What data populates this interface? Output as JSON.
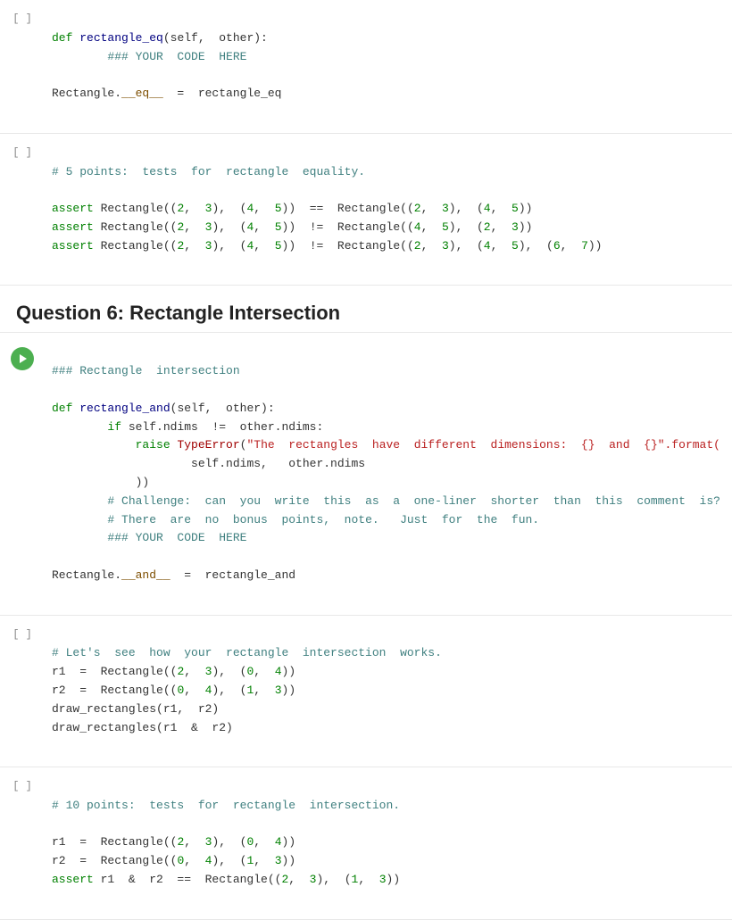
{
  "section_header": "Question 6: Rectangle Intersection",
  "cells": [
    {
      "id": "cell-eq-def",
      "gutter": "[ ]",
      "type": "code",
      "lines": [
        {
          "parts": [
            {
              "text": "def ",
              "cls": "kw"
            },
            {
              "text": "rectangle_eq",
              "cls": "fn"
            },
            {
              "text": "(self,  other):",
              "cls": "bl"
            }
          ]
        },
        {
          "parts": [
            {
              "text": "        ",
              "cls": "bl"
            },
            {
              "text": "### YOUR  CODE  HERE",
              "cls": "comment"
            }
          ]
        },
        {
          "parts": [
            {
              "text": "",
              "cls": "bl"
            }
          ]
        },
        {
          "parts": [
            {
              "text": "Rectangle.",
              "cls": "bl"
            },
            {
              "text": "__eq__",
              "cls": "attr"
            },
            {
              "text": "  =  rectangle_eq",
              "cls": "bl"
            }
          ]
        }
      ]
    },
    {
      "id": "cell-eq-test",
      "gutter": "[ ]",
      "type": "code",
      "lines": [
        {
          "parts": [
            {
              "text": "# 5 points:  tests  for  rectangle  equality.",
              "cls": "comment"
            }
          ]
        },
        {
          "parts": [
            {
              "text": "",
              "cls": "bl"
            }
          ]
        },
        {
          "parts": [
            {
              "text": "assert ",
              "cls": "assert-kw"
            },
            {
              "text": "Rectangle((",
              "cls": "bl"
            },
            {
              "text": "2",
              "cls": "num"
            },
            {
              "text": ",  ",
              "cls": "bl"
            },
            {
              "text": "3",
              "cls": "num"
            },
            {
              "text": "),   (",
              "cls": "bl"
            },
            {
              "text": "4",
              "cls": "num"
            },
            {
              "text": ",   ",
              "cls": "bl"
            },
            {
              "text": "5",
              "cls": "num"
            },
            {
              "text": "))   ==   Rectangle((",
              "cls": "bl"
            },
            {
              "text": "2",
              "cls": "num"
            },
            {
              "text": ",   ",
              "cls": "bl"
            },
            {
              "text": "3",
              "cls": "num"
            },
            {
              "text": "),   (",
              "cls": "bl"
            },
            {
              "text": "4",
              "cls": "num"
            },
            {
              "text": ",   ",
              "cls": "bl"
            },
            {
              "text": "5",
              "cls": "num"
            },
            {
              "text": "))",
              "cls": "bl"
            }
          ]
        },
        {
          "parts": [
            {
              "text": "assert ",
              "cls": "assert-kw"
            },
            {
              "text": "Rectangle((",
              "cls": "bl"
            },
            {
              "text": "2",
              "cls": "num"
            },
            {
              "text": ",  ",
              "cls": "bl"
            },
            {
              "text": "3",
              "cls": "num"
            },
            {
              "text": "),   (",
              "cls": "bl"
            },
            {
              "text": "4",
              "cls": "num"
            },
            {
              "text": ",   ",
              "cls": "bl"
            },
            {
              "text": "5",
              "cls": "num"
            },
            {
              "text": "))   !=   Rectangle((",
              "cls": "bl"
            },
            {
              "text": "4",
              "cls": "num"
            },
            {
              "text": ",   ",
              "cls": "bl"
            },
            {
              "text": "5",
              "cls": "num"
            },
            {
              "text": "),   (",
              "cls": "bl"
            },
            {
              "text": "2",
              "cls": "num"
            },
            {
              "text": ",   ",
              "cls": "bl"
            },
            {
              "text": "3",
              "cls": "num"
            },
            {
              "text": "))",
              "cls": "bl"
            }
          ]
        },
        {
          "parts": [
            {
              "text": "assert ",
              "cls": "assert-kw"
            },
            {
              "text": "Rectangle((",
              "cls": "bl"
            },
            {
              "text": "2",
              "cls": "num"
            },
            {
              "text": ",  ",
              "cls": "bl"
            },
            {
              "text": "3",
              "cls": "num"
            },
            {
              "text": "),   (",
              "cls": "bl"
            },
            {
              "text": "4",
              "cls": "num"
            },
            {
              "text": ",   ",
              "cls": "bl"
            },
            {
              "text": "5",
              "cls": "num"
            },
            {
              "text": "))   !=   Rectangle((",
              "cls": "bl"
            },
            {
              "text": "2",
              "cls": "num"
            },
            {
              "text": ",   ",
              "cls": "bl"
            },
            {
              "text": "3",
              "cls": "num"
            },
            {
              "text": "),   (",
              "cls": "bl"
            },
            {
              "text": "4",
              "cls": "num"
            },
            {
              "text": ",   ",
              "cls": "bl"
            },
            {
              "text": "5",
              "cls": "num"
            },
            {
              "text": "),   (",
              "cls": "bl"
            },
            {
              "text": "6",
              "cls": "num"
            },
            {
              "text": ",   ",
              "cls": "bl"
            },
            {
              "text": "7",
              "cls": "num"
            },
            {
              "text": "))",
              "cls": "bl"
            }
          ]
        }
      ]
    },
    {
      "id": "cell-and-def",
      "gutter": "[ ]",
      "type": "code",
      "has_run_btn": true,
      "lines": [
        {
          "parts": [
            {
              "text": "### Rectangle  intersection",
              "cls": "comment"
            }
          ]
        },
        {
          "parts": [
            {
              "text": "",
              "cls": "bl"
            }
          ]
        },
        {
          "parts": [
            {
              "text": "def ",
              "cls": "kw"
            },
            {
              "text": "rectangle_and",
              "cls": "fn"
            },
            {
              "text": "(self,  other):",
              "cls": "bl"
            }
          ]
        },
        {
          "parts": [
            {
              "text": "        ",
              "cls": "bl"
            },
            {
              "text": "if ",
              "cls": "kw"
            },
            {
              "text": "self.ndims  !=  other.ndims:",
              "cls": "bl"
            }
          ]
        },
        {
          "parts": [
            {
              "text": "            ",
              "cls": "bl"
            },
            {
              "text": "raise ",
              "cls": "kw"
            },
            {
              "text": "TypeError",
              "cls": "type-err"
            },
            {
              "text": "(",
              "cls": "bl"
            },
            {
              "text": "\"The  rectangles  have  different  dimensions:  {}  and  {}\".format(",
              "cls": "string"
            }
          ]
        },
        {
          "parts": [
            {
              "text": "                    ",
              "cls": "bl"
            },
            {
              "text": "self.ndims,   other.ndims",
              "cls": "bl"
            }
          ]
        },
        {
          "parts": [
            {
              "text": "            ",
              "cls": "bl"
            },
            {
              "text": "))",
              "cls": "bl"
            }
          ]
        },
        {
          "parts": [
            {
              "text": "        ",
              "cls": "bl"
            },
            {
              "text": "# Challenge:  can  you  write  this  as  a  one-liner  shorter  than  this  comment  is?",
              "cls": "comment"
            }
          ]
        },
        {
          "parts": [
            {
              "text": "        ",
              "cls": "bl"
            },
            {
              "text": "# There  are  no  bonus  points,  note.   Just  for  the  fun.",
              "cls": "comment"
            }
          ]
        },
        {
          "parts": [
            {
              "text": "        ",
              "cls": "bl"
            },
            {
              "text": "### YOUR  CODE  HERE",
              "cls": "comment"
            }
          ]
        },
        {
          "parts": [
            {
              "text": "",
              "cls": "bl"
            }
          ]
        },
        {
          "parts": [
            {
              "text": "Rectangle.",
              "cls": "bl"
            },
            {
              "text": "__and__",
              "cls": "attr"
            },
            {
              "text": "  =  rectangle_and",
              "cls": "bl"
            }
          ]
        }
      ]
    },
    {
      "id": "cell-draw",
      "gutter": "[ ]",
      "type": "code",
      "lines": [
        {
          "parts": [
            {
              "text": "# Let's  see  how  your  rectangle  intersection  works.",
              "cls": "comment"
            }
          ]
        },
        {
          "parts": [
            {
              "text": "r1  =  Rectangle((",
              "cls": "bl"
            },
            {
              "text": "2",
              "cls": "num"
            },
            {
              "text": ",  ",
              "cls": "bl"
            },
            {
              "text": "3",
              "cls": "num"
            },
            {
              "text": "),  (",
              "cls": "bl"
            },
            {
              "text": "0",
              "cls": "num"
            },
            {
              "text": ",  ",
              "cls": "bl"
            },
            {
              "text": "4",
              "cls": "num"
            },
            {
              "text": "))",
              "cls": "bl"
            }
          ]
        },
        {
          "parts": [
            {
              "text": "r2  =  Rectangle((",
              "cls": "bl"
            },
            {
              "text": "0",
              "cls": "num"
            },
            {
              "text": ",  ",
              "cls": "bl"
            },
            {
              "text": "4",
              "cls": "num"
            },
            {
              "text": "),  (",
              "cls": "bl"
            },
            {
              "text": "1",
              "cls": "num"
            },
            {
              "text": ",  ",
              "cls": "bl"
            },
            {
              "text": "3",
              "cls": "num"
            },
            {
              "text": "))",
              "cls": "bl"
            }
          ]
        },
        {
          "parts": [
            {
              "text": "draw_rectangles(r1,  r2)",
              "cls": "bl"
            }
          ]
        },
        {
          "parts": [
            {
              "text": "draw_rectangles(r1  &  r2)",
              "cls": "bl"
            }
          ]
        }
      ]
    },
    {
      "id": "cell-and-test",
      "gutter": "[ ]",
      "type": "code",
      "lines": [
        {
          "parts": [
            {
              "text": "# 10 points:  tests  for  rectangle  intersection.",
              "cls": "comment"
            }
          ]
        },
        {
          "parts": [
            {
              "text": "",
              "cls": "bl"
            }
          ]
        },
        {
          "parts": [
            {
              "text": "r1  =  Rectangle((",
              "cls": "bl"
            },
            {
              "text": "2",
              "cls": "num"
            },
            {
              "text": ",  ",
              "cls": "bl"
            },
            {
              "text": "3",
              "cls": "num"
            },
            {
              "text": "),  (",
              "cls": "bl"
            },
            {
              "text": "0",
              "cls": "num"
            },
            {
              "text": ",  ",
              "cls": "bl"
            },
            {
              "text": "4",
              "cls": "num"
            },
            {
              "text": "))",
              "cls": "bl"
            }
          ]
        },
        {
          "parts": [
            {
              "text": "r2  =  Rectangle((",
              "cls": "bl"
            },
            {
              "text": "0",
              "cls": "num"
            },
            {
              "text": ",  ",
              "cls": "bl"
            },
            {
              "text": "4",
              "cls": "num"
            },
            {
              "text": "),  (",
              "cls": "bl"
            },
            {
              "text": "1",
              "cls": "num"
            },
            {
              "text": ",  ",
              "cls": "bl"
            },
            {
              "text": "3",
              "cls": "num"
            },
            {
              "text": "))",
              "cls": "bl"
            }
          ]
        },
        {
          "parts": [
            {
              "text": "assert ",
              "cls": "assert-kw"
            },
            {
              "text": "r1  &  r2  ==  Rectangle((",
              "cls": "bl"
            },
            {
              "text": "2",
              "cls": "num"
            },
            {
              "text": ",  ",
              "cls": "bl"
            },
            {
              "text": "3",
              "cls": "num"
            },
            {
              "text": "),  (",
              "cls": "bl"
            },
            {
              "text": "1",
              "cls": "num"
            },
            {
              "text": ",  ",
              "cls": "bl"
            },
            {
              "text": "3",
              "cls": "num"
            },
            {
              "text": "))",
              "cls": "bl"
            }
          ]
        }
      ]
    }
  ]
}
